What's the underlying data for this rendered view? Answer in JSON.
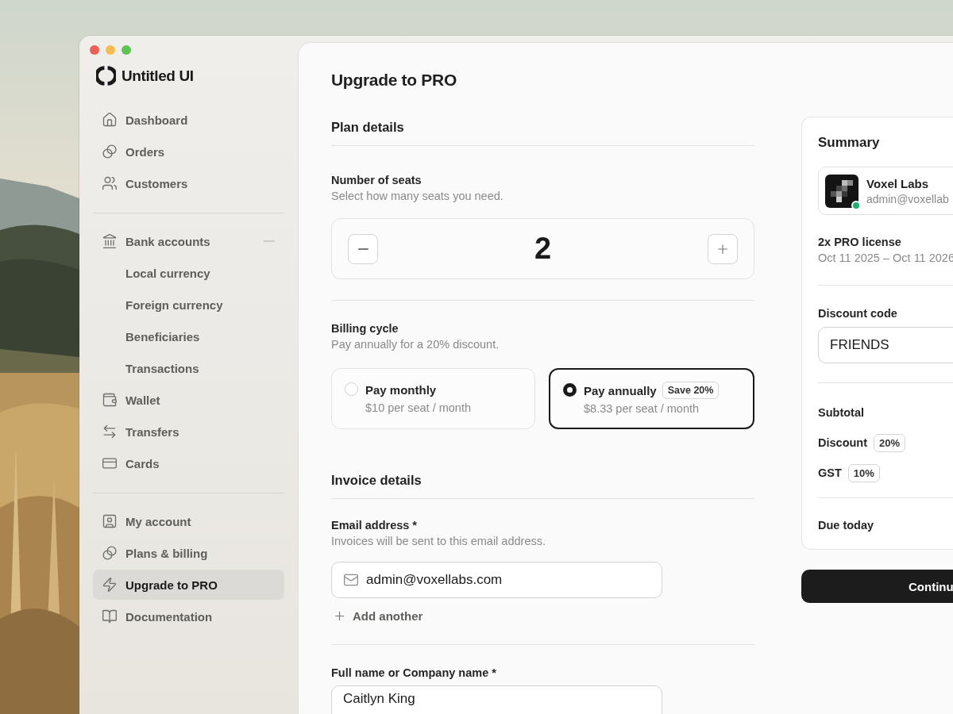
{
  "window": {
    "traffic_lights": [
      {
        "color": "#ee5f57"
      },
      {
        "color": "#f5bd4f"
      },
      {
        "color": "#5fc453"
      }
    ]
  },
  "sidebar": {
    "logo": "Untitled UI",
    "sections": [
      {
        "items": [
          {
            "label": "Dashboard",
            "selected": false
          },
          {
            "label": "Orders",
            "selected": false
          },
          {
            "label": "Customers",
            "selected": false
          }
        ]
      },
      {
        "items": [
          {
            "label": "Bank accounts",
            "selected": false,
            "expanded": true,
            "children": [
              {
                "label": "Local currency",
                "selected": false
              },
              {
                "label": "Foreign currency",
                "selected": false
              },
              {
                "label": "Beneficiaries",
                "selected": false
              },
              {
                "label": "Transactions",
                "selected": false
              }
            ]
          },
          {
            "label": "Wallet",
            "selected": false
          },
          {
            "label": "Transfers",
            "selected": false
          },
          {
            "label": "Cards",
            "selected": false
          }
        ]
      },
      {
        "items": [
          {
            "label": "My account",
            "selected": false
          },
          {
            "label": "Plans & billing",
            "selected": false
          },
          {
            "label": "Upgrade to PRO",
            "selected": true
          },
          {
            "label": "Documentation",
            "selected": false
          }
        ]
      }
    ]
  },
  "page": {
    "title": "Upgrade to PRO"
  },
  "plan_details": {
    "heading": "Plan details",
    "seats": {
      "label": "Number of seats",
      "hint": "Select how many seats you need.",
      "value": "2"
    },
    "billing": {
      "label": "Billing cycle",
      "hint": "Pay annually for a 20% discount.",
      "options": [
        {
          "title": "Pay monthly",
          "price": "$10 per seat / month",
          "selected": false
        },
        {
          "title": "Pay annually",
          "badge": "Save 20%",
          "price": "$8.33 per seat / month",
          "selected": true
        }
      ]
    }
  },
  "invoice_details": {
    "heading": "Invoice details",
    "email": {
      "label": "Email address *",
      "hint": "Invoices will be sent to this email address.",
      "value": "admin@voxellabs.com",
      "add_link": "Add another"
    },
    "name": {
      "label": "Full name or Company name *",
      "value": "Caitlyn King"
    }
  },
  "summary": {
    "title": "Summary",
    "account": {
      "name": "Voxel Labs",
      "email": "admin@voxellab",
      "online": true
    },
    "license": {
      "title": "2x PRO license",
      "dates": "Oct 11 2025 – Oct 11 2026"
    },
    "discount_code": {
      "label": "Discount code",
      "value": "FRIENDS"
    },
    "lines": [
      {
        "label": "Subtotal"
      },
      {
        "label": "Discount",
        "badge": "20%"
      },
      {
        "label": "GST",
        "badge": "10%"
      }
    ],
    "due": {
      "label": "Due today"
    },
    "button": "Continu"
  }
}
